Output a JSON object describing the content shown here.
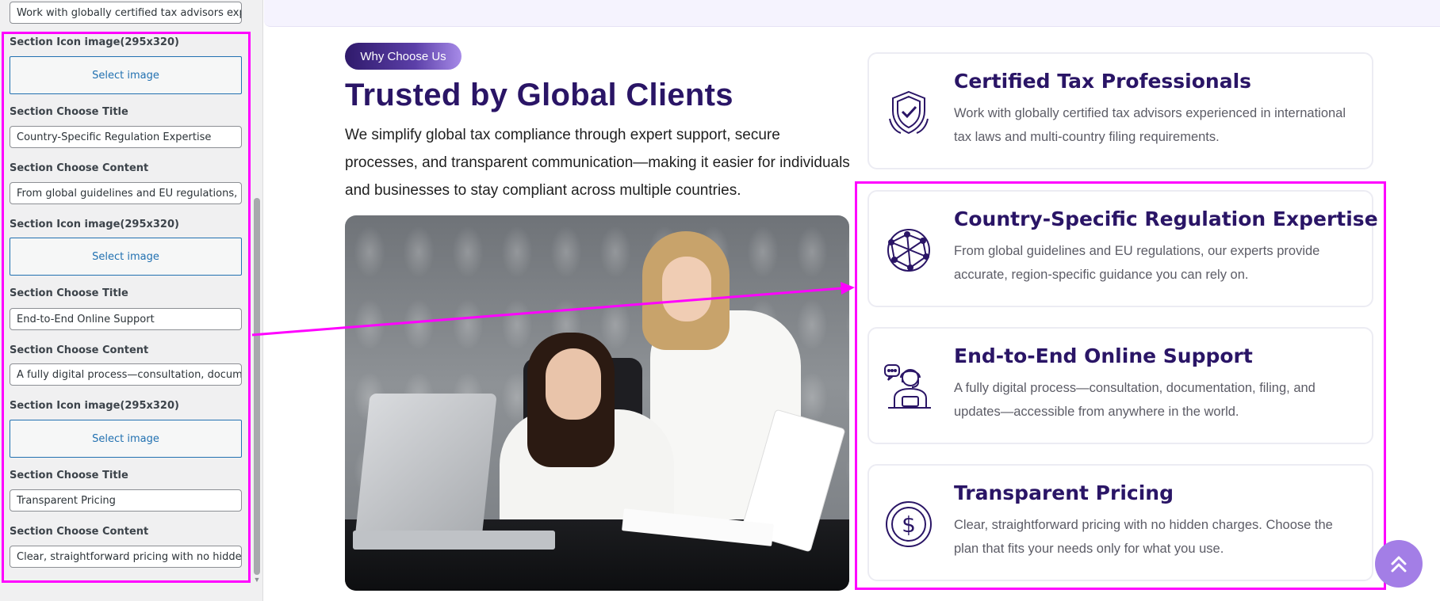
{
  "sidebar": {
    "top_field_value": "Work with globally certified tax advisors exp",
    "label_icon": "Section Icon image(295x320)",
    "label_title": "Section Choose Title",
    "label_content": "Section Choose Content",
    "select_image": "Select image",
    "items": [
      {
        "title": "Country-Specific Regulation Expertise",
        "content": "From global guidelines and EU regulations, o"
      },
      {
        "title": "End-to-End Online Support",
        "content": "A fully digital process—consultation, docum"
      },
      {
        "title": "Transparent Pricing",
        "content": "Clear, straightforward pricing with no hidde"
      }
    ]
  },
  "main": {
    "badge": "Why Choose Us",
    "heading": "Trusted by Global Clients",
    "intro": "We simplify global tax compliance through expert support, secure processes, and transparent communication—making it easier for individuals and businesses to stay compliant across multiple countries.",
    "cards": [
      {
        "icon": "shield-check-icon",
        "title": "Certified Tax Professionals",
        "text": "Work with globally certified tax advisors experienced in international tax laws and multi-country filing requirements."
      },
      {
        "icon": "globe-network-icon",
        "title": "Country-Specific Regulation Expertise",
        "text": "From global guidelines and EU regulations, our experts provide accurate, region-specific guidance you can rely on."
      },
      {
        "icon": "support-agent-icon",
        "title": "End-to-End Online Support",
        "text": "A fully digital process—consultation, documentation, filing, and updates—accessible from anywhere in the world."
      },
      {
        "icon": "dollar-coin-icon",
        "title": "Transparent Pricing",
        "text": "Clear, straightforward pricing with no hidden charges. Choose the plan that fits your needs only for what you use."
      }
    ]
  },
  "colors": {
    "heading": "#2a1566",
    "annotation": "#ff00ff",
    "accent": "#a37ee6",
    "link": "#2271b1"
  },
  "icons": {
    "back_to_top": "double-chevron-up-icon"
  }
}
